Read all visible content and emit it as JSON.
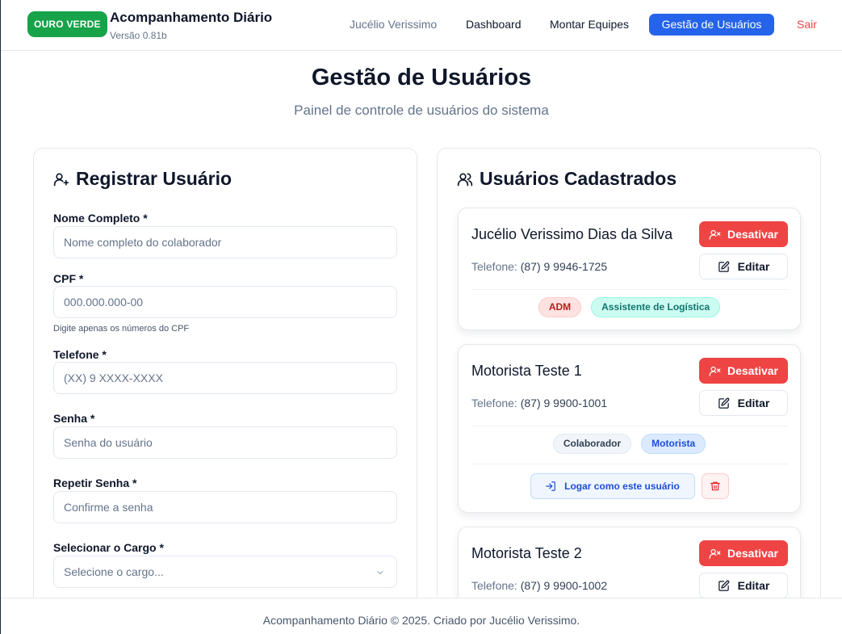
{
  "header": {
    "badge": "OURO VERDE",
    "title": "Acompanhamento Diário",
    "version": "Versão 0.81b",
    "user_name": "Jucélio Verissimo",
    "nav": {
      "dashboard": "Dashboard",
      "equipes": "Montar Equipes",
      "usuarios": "Gestão de Usuários",
      "logout": "Sair"
    }
  },
  "page": {
    "title": "Gestão de Usuários",
    "subtitle": "Painel de controle de usuários do sistema"
  },
  "register": {
    "title": "Registrar Usuário",
    "fields": {
      "name": {
        "label": "Nome Completo *",
        "placeholder": "Nome completo do colaborador"
      },
      "cpf": {
        "label": "CPF *",
        "placeholder": "000.000.000-00",
        "hint": "Digite apenas os números do CPF"
      },
      "phone": {
        "label": "Telefone *",
        "placeholder": "(XX) 9 XXXX-XXXX"
      },
      "password": {
        "label": "Senha *",
        "placeholder": "Senha do usuário"
      },
      "password_confirm": {
        "label": "Repetir Senha *",
        "placeholder": "Confirme a senha"
      },
      "role": {
        "label": "Selecionar o Cargo *",
        "placeholder": "Selecione o cargo..."
      }
    }
  },
  "users": {
    "title": "Usuários Cadastrados",
    "phone_label": "Telefone:",
    "deactivate_label": "Desativar",
    "edit_label": "Editar",
    "login_as_label": "Logar como este usuário",
    "list": [
      {
        "name": "Jucélio Verissimo Dias da Silva",
        "phone": "(87) 9 9946-1725",
        "tags": [
          "ADM",
          "Assistente de Logística"
        ]
      },
      {
        "name": "Motorista Teste 1",
        "phone": "(87) 9 9900-1001",
        "tags": [
          "Colaborador",
          "Motorista"
        ]
      },
      {
        "name": "Motorista Teste 2",
        "phone": "(87) 9 9900-1002",
        "tags": []
      }
    ]
  },
  "footer": {
    "text": "Acompanhamento Diário © 2025. Criado por Jucélio Verissimo."
  },
  "colors": {
    "brand": "#16a34a",
    "primary": "#2563eb",
    "danger": "#ef4444"
  }
}
